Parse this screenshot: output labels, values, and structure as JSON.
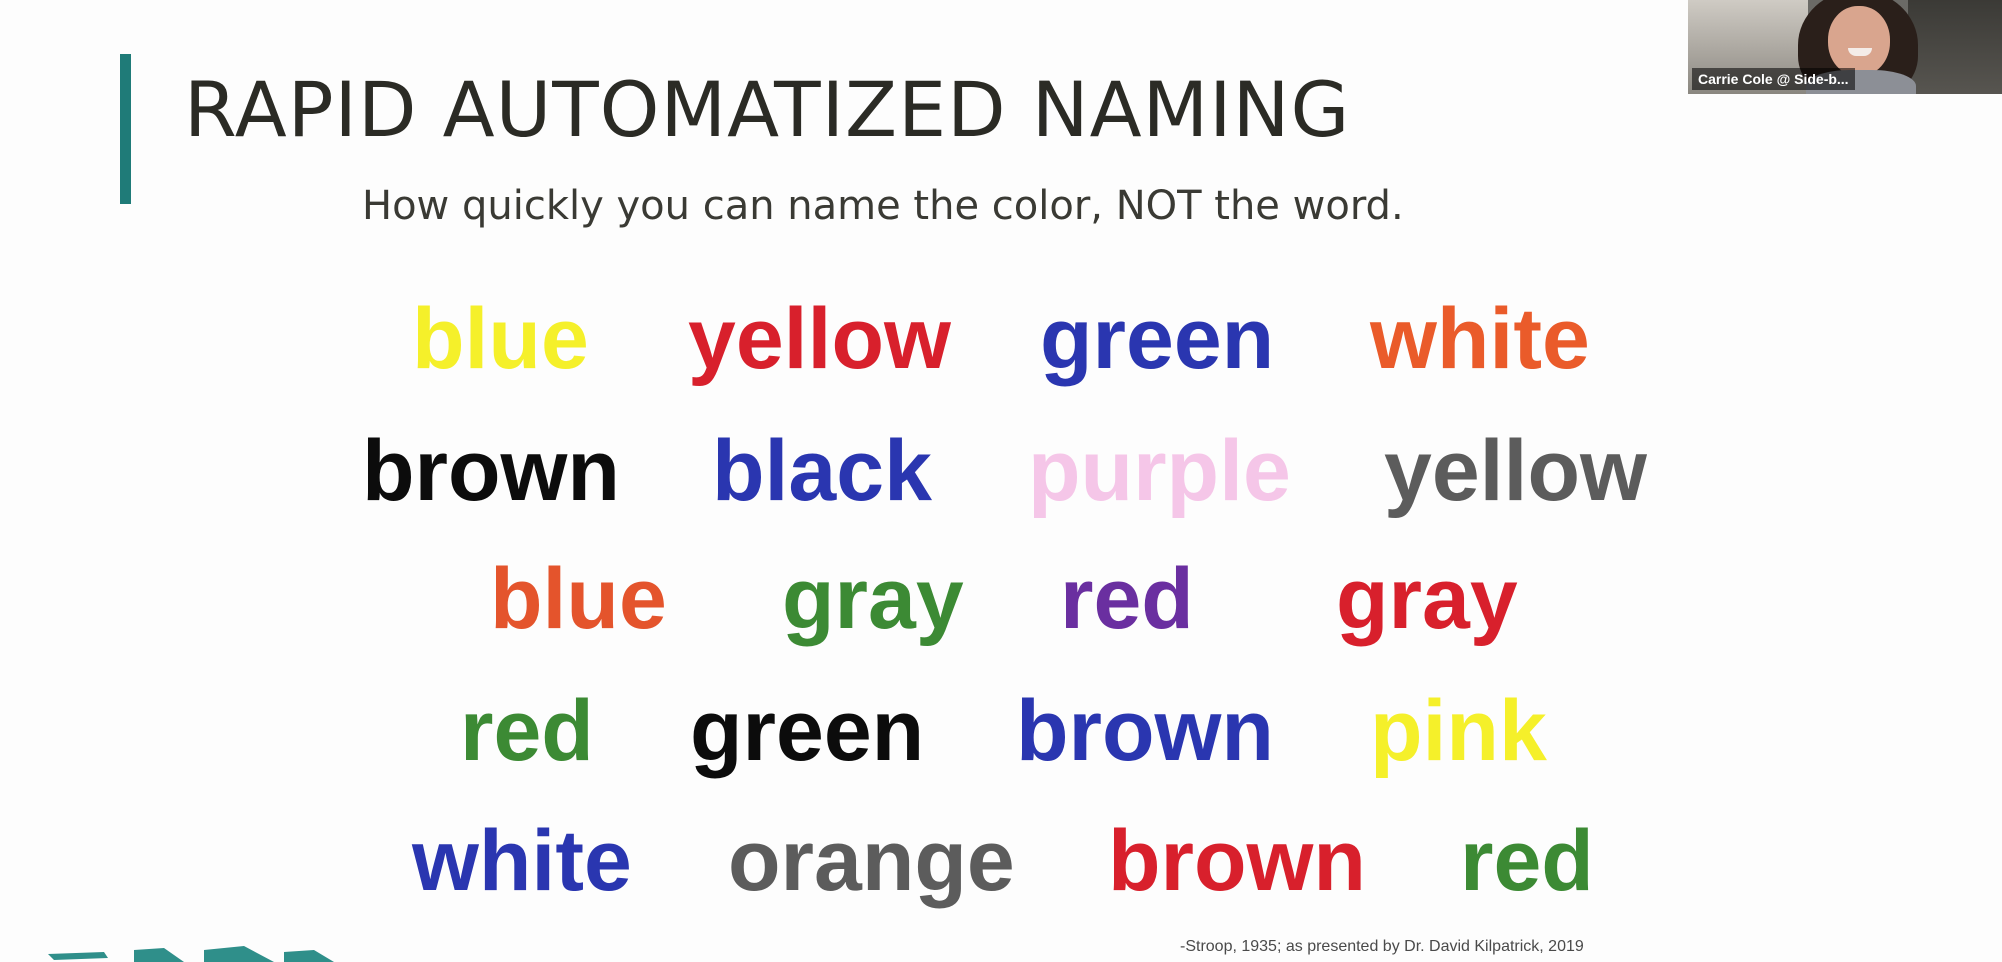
{
  "slide": {
    "title": "RAPID AUTOMATIZED NAMING",
    "subtitle": "How quickly you can name the color, NOT the word.",
    "accent_color": "#1f7b78",
    "citation": "-Stroop, 1935; as presented by Dr. David Kilpatrick, 2019"
  },
  "stroop_words": [
    [
      {
        "text": "blue",
        "color": "#f5f02a"
      },
      {
        "text": "yellow",
        "color": "#d8202c"
      },
      {
        "text": "green",
        "color": "#2a36b0"
      },
      {
        "text": "white",
        "color": "#ea5b2a"
      }
    ],
    [
      {
        "text": "brown",
        "color": "#0c0c0c"
      },
      {
        "text": "black",
        "color": "#2a36b0"
      },
      {
        "text": "purple",
        "color": "#f5c6e8"
      },
      {
        "text": "yellow",
        "color": "#5c5c5c"
      }
    ],
    [
      {
        "text": "blue",
        "color": "#e4542c"
      },
      {
        "text": "gray",
        "color": "#3c8a34"
      },
      {
        "text": "red",
        "color": "#6a2fa0"
      },
      {
        "text": "gray",
        "color": "#d8202c"
      }
    ],
    [
      {
        "text": "red",
        "color": "#3c8a34"
      },
      {
        "text": "green",
        "color": "#0c0c0c"
      },
      {
        "text": "brown",
        "color": "#2a36b0"
      },
      {
        "text": "pink",
        "color": "#f5f02a"
      }
    ],
    [
      {
        "text": "white",
        "color": "#2a36b0"
      },
      {
        "text": "orange",
        "color": "#5c5c5c"
      },
      {
        "text": "brown",
        "color": "#d8202c"
      },
      {
        "text": "red",
        "color": "#3c8a34"
      }
    ]
  ],
  "video": {
    "participant_name": "Carrie Cole @ Side-b..."
  },
  "logo": {
    "color": "#2f8f8a"
  }
}
